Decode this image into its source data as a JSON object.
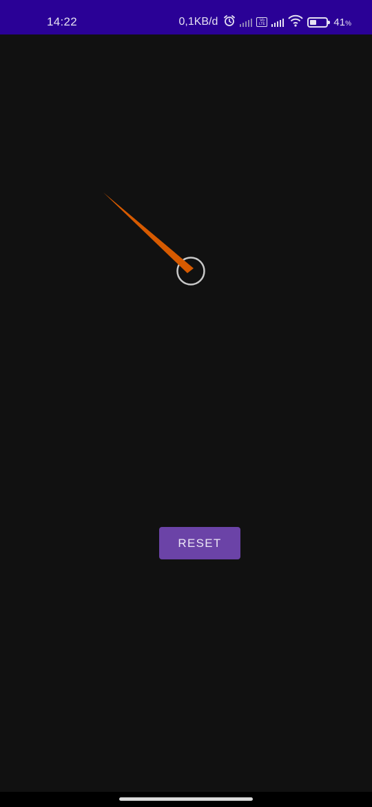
{
  "status_bar": {
    "time": "14:22",
    "network_speed": "0,1KB/d",
    "battery_percent": "41",
    "battery_percent_sign": "%",
    "battery_level": 0.41,
    "volte_label": "Vo\nLTE",
    "icons": [
      "alarm-icon",
      "signal-icon",
      "volte-icon",
      "signal-icon",
      "wifi-icon",
      "battery-icon"
    ],
    "background_color": "#2a0196"
  },
  "gauge": {
    "needle_color": "#d65a00",
    "pivot_ring_color": "#c8c8c8"
  },
  "reset_button": {
    "label": "RESET",
    "color": "#6b43a7"
  },
  "background_color": "#111111"
}
